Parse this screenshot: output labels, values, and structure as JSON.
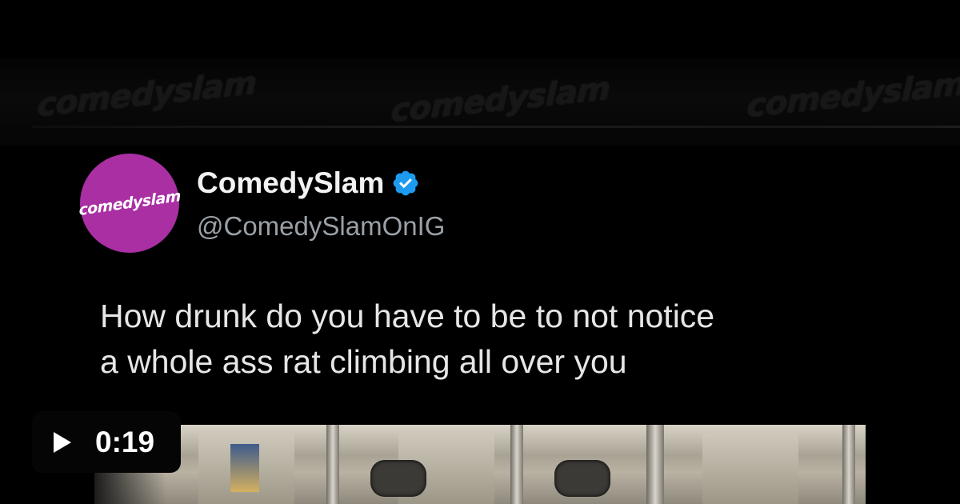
{
  "watermark": {
    "text": "comedyslam"
  },
  "author": {
    "avatar_text": "comedyslam",
    "display_name": "ComedySlam",
    "handle": "@ComedySlamOnIG",
    "verified": true,
    "avatar_color": "#a92fa3",
    "verified_color": "#1d9bf0"
  },
  "tweet": {
    "line1": "How drunk do you have to be to not notice",
    "line2": "a whole ass rat climbing all over you"
  },
  "video": {
    "duration": "0:19",
    "play_icon": "play-icon"
  }
}
